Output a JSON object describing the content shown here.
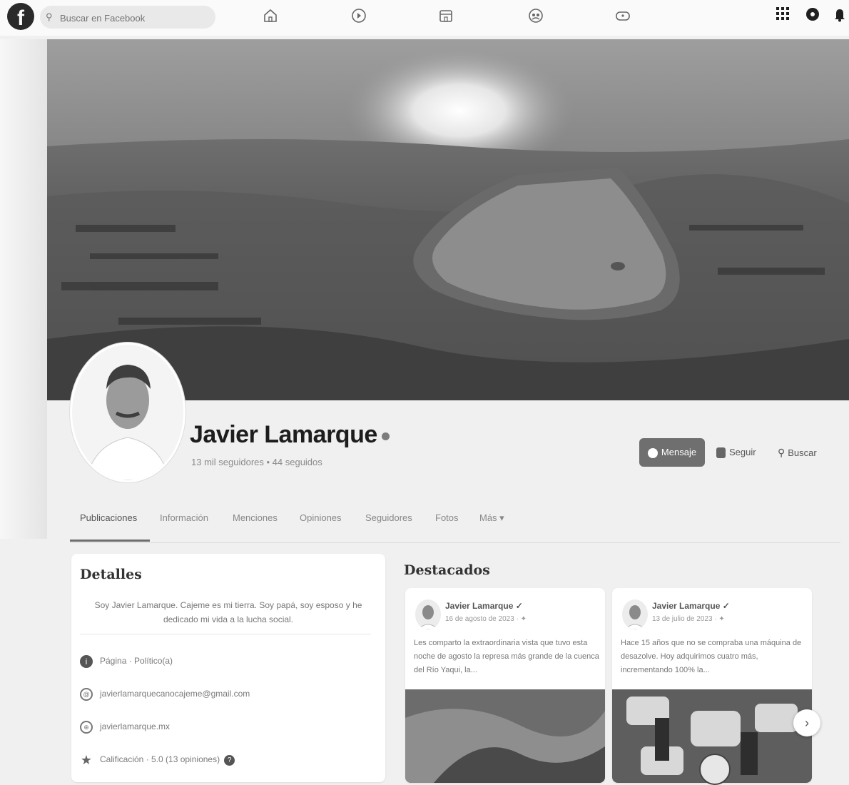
{
  "topbar": {
    "search_placeholder": "Buscar en Facebook",
    "logo": "f"
  },
  "profile": {
    "name": "Javier Lamarque",
    "followers": "13 mil seguidores • 44 seguidos",
    "message_label": "Mensaje",
    "follow_label": "Seguir",
    "search_label": "Buscar"
  },
  "tabs": [
    "Publicaciones",
    "Información",
    "Menciones",
    "Opiniones",
    "Seguidores",
    "Fotos",
    "Más ▾"
  ],
  "details": {
    "title": "Detalles",
    "bio": "Soy Javier Lamarque. Cajeme es mi tierra. Soy papá, soy esposo y he dedicado mi vida a la lucha social.",
    "page_type": "Página · Político(a)",
    "email": "javierlamarquecanocajeme@gmail.com",
    "website": "javierlamarque.mx",
    "rating": "Calificación · 5.0 (13 opiniones)"
  },
  "highlights": {
    "title": "Destacados",
    "posts": [
      {
        "author": "Javier Lamarque ✓",
        "date": "16 de agosto de 2023 · ✦",
        "text": "Les comparto la extraordinaria vista que tuvo esta noche de agosto la represa más grande de la cuenca del Río Yaqui, la..."
      },
      {
        "author": "Javier Lamarque ✓",
        "date": "13 de julio de 2023 · ✦",
        "text": "Hace 15 años que no se compraba una máquina de desazolve. Hoy adquirimos cuatro más, incrementando 100% la..."
      }
    ]
  },
  "icons": {
    "home": "home-icon",
    "watch": "watch-icon",
    "marketplace": "marketplace-icon",
    "groups": "groups-icon",
    "gaming": "gaming-icon",
    "menu": "grid-menu-icon",
    "messenger": "messenger-icon",
    "notifications": "bell-icon"
  }
}
